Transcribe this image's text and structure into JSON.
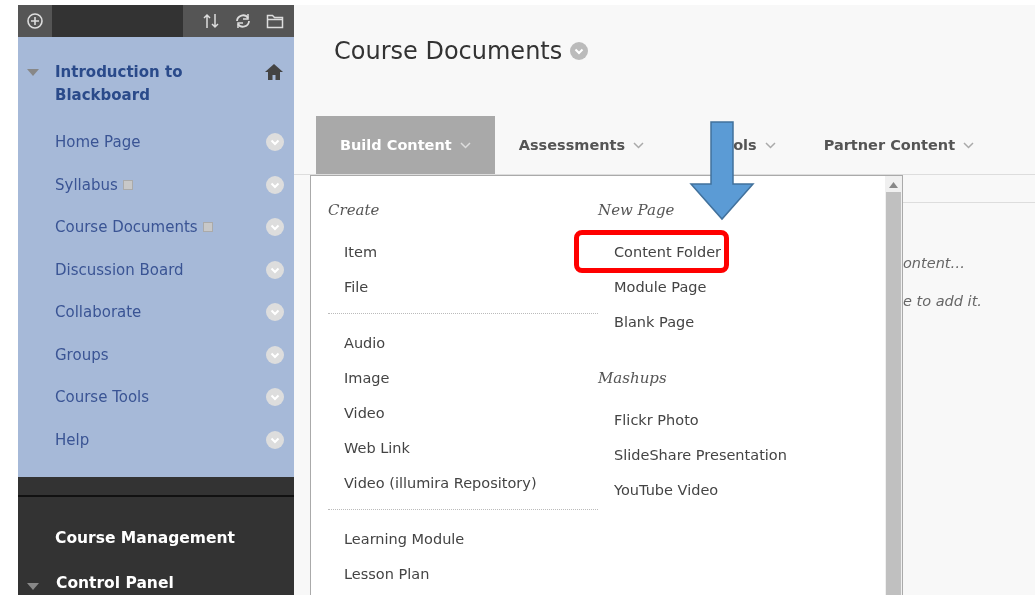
{
  "sidebar": {
    "course": {
      "title": "Introduction to Blackboard",
      "expanded": true
    },
    "items": [
      {
        "label": "Home Page",
        "badge": false
      },
      {
        "label": "Syllabus",
        "badge": true
      },
      {
        "label": "Course Documents",
        "badge": true
      },
      {
        "label": "Discussion Board",
        "badge": false
      },
      {
        "label": "Collaborate",
        "badge": false
      },
      {
        "label": "Groups",
        "badge": false
      },
      {
        "label": "Course Tools",
        "badge": false
      },
      {
        "label": "Help",
        "badge": false
      }
    ],
    "management": {
      "title": "Course Management",
      "panel": "Control Panel",
      "expanded": true
    }
  },
  "page": {
    "title": "Course Documents",
    "tabs": [
      {
        "label": "Build Content",
        "selected": true
      },
      {
        "label": "Assessments",
        "selected": false
      },
      {
        "label": "ols",
        "selected": false
      },
      {
        "label": "Partner Content",
        "selected": false
      }
    ],
    "background_texts": [
      "ontent…",
      "e to add it."
    ]
  },
  "menu": {
    "columns": [
      {
        "sections": [
          {
            "heading": "Create",
            "items": [
              {
                "label": "Item",
                "highlighted": false
              },
              {
                "label": "File",
                "highlighted": false
              }
            ]
          },
          {
            "items": [
              {
                "label": "Audio",
                "highlighted": false
              },
              {
                "label": "Image",
                "highlighted": false
              },
              {
                "label": "Video",
                "highlighted": false
              },
              {
                "label": "Web Link",
                "highlighted": false
              },
              {
                "label": "Video (illumira Repository)",
                "highlighted": false
              }
            ]
          },
          {
            "items": [
              {
                "label": "Learning Module",
                "highlighted": false
              },
              {
                "label": "Lesson Plan",
                "highlighted": false
              }
            ]
          }
        ]
      },
      {
        "sections": [
          {
            "heading": "New Page",
            "items": [
              {
                "label": "Content Folder",
                "highlighted": true
              },
              {
                "label": "Module Page",
                "highlighted": false
              },
              {
                "label": "Blank Page",
                "highlighted": false
              }
            ]
          },
          {
            "heading": "Mashups",
            "items": [
              {
                "label": "Flickr Photo",
                "highlighted": false
              },
              {
                "label": "SlideShare Presentation",
                "highlighted": false
              },
              {
                "label": "YouTube Video",
                "highlighted": false
              }
            ]
          }
        ]
      }
    ]
  }
}
